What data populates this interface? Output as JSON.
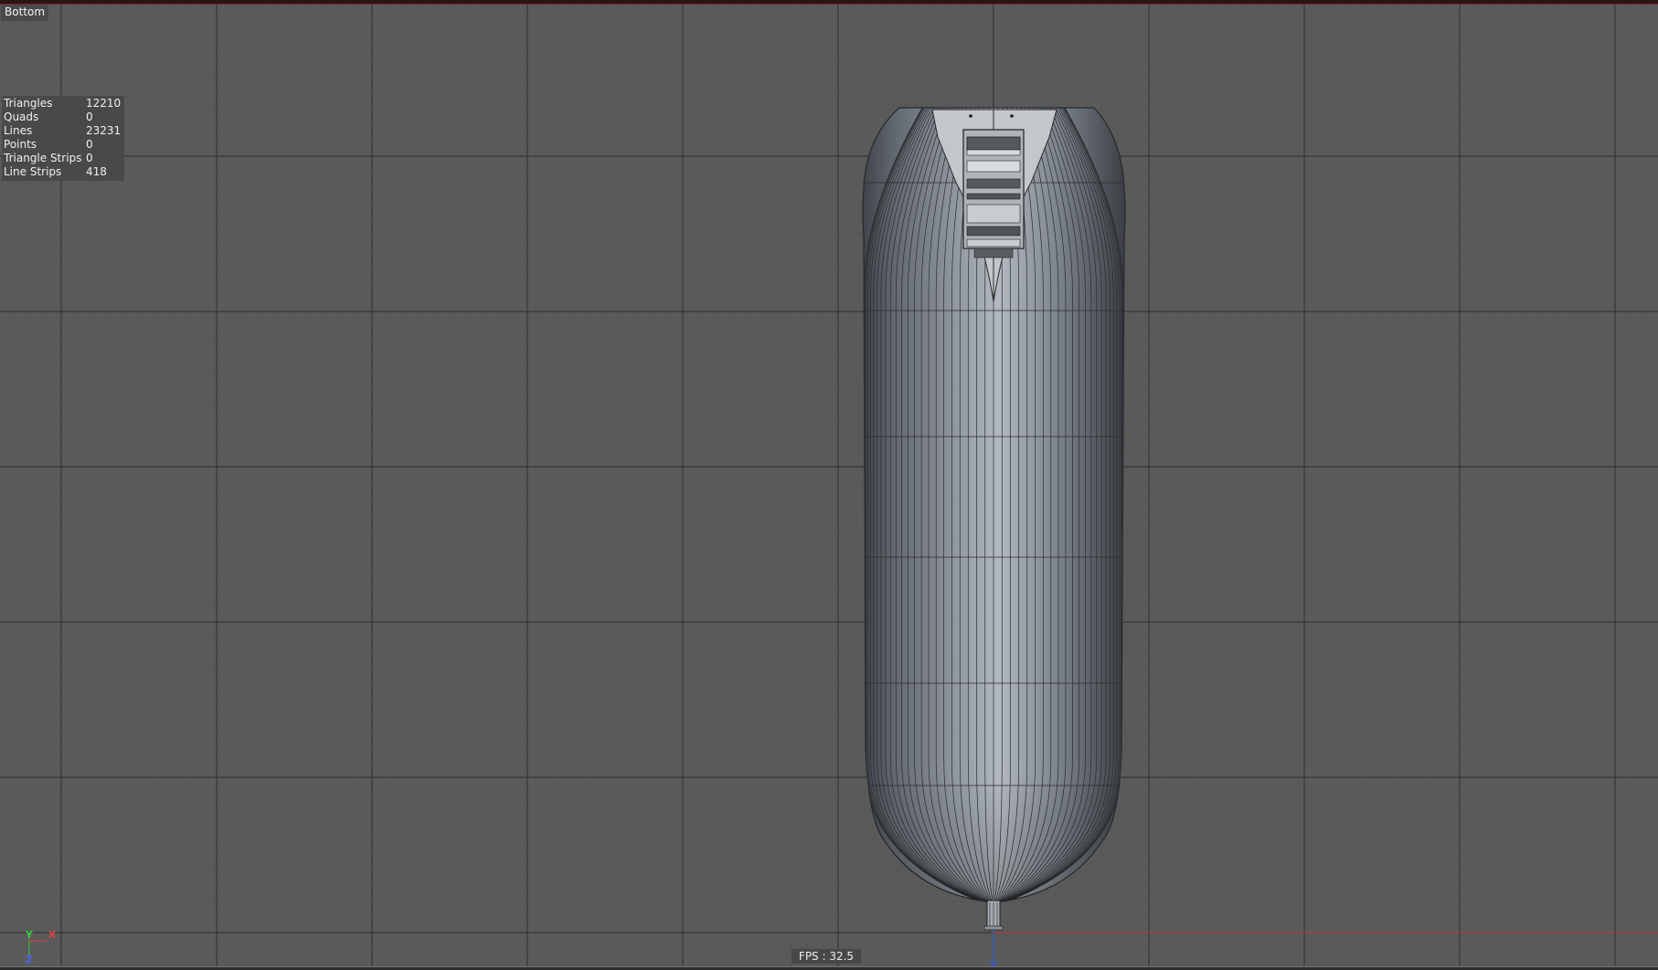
{
  "viewport": {
    "view_name": "Bottom",
    "colors": {
      "background": "#5a5a5a",
      "grid_major": "#2f2f2f",
      "grid_minor": "#555555",
      "x_axis": "#c83232",
      "y_axis": "#2f5fd0",
      "model_light": "#9aa2ab",
      "model_dark": "#3c4046"
    }
  },
  "stats": {
    "triangles_label": "Triangles",
    "triangles_value": "12210",
    "quads_label": "Quads",
    "quads_value": "0",
    "lines_label": "Lines",
    "lines_value": "23231",
    "points_label": "Points",
    "points_value": "0",
    "triangle_strips_label": "Triangle Strips",
    "triangle_strips_value": "0",
    "line_strips_label": "Line Strips",
    "line_strips_value": "418"
  },
  "fps": {
    "label": "FPS : 32.5"
  },
  "axis_gizmo": {
    "y_label": "Y",
    "x_label": "X",
    "z_label": "Z"
  }
}
